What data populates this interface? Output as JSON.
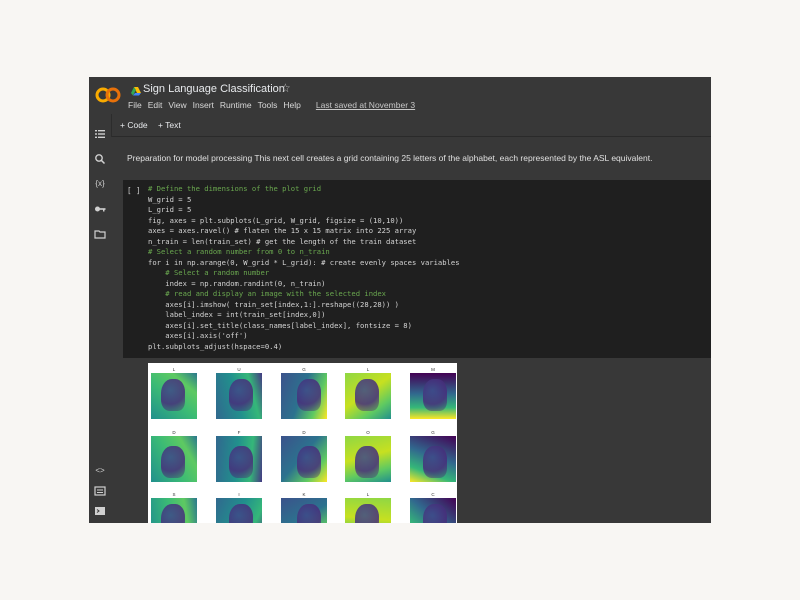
{
  "app": {
    "title": "Sign Language Classification",
    "menu": [
      "File",
      "Edit",
      "View",
      "Insert",
      "Runtime",
      "Tools",
      "Help"
    ],
    "last_saved": "Last saved at November 3",
    "accent": "#f9ab00"
  },
  "toolbar": {
    "code_label": "+ Code",
    "text_label": "+ Text"
  },
  "sidebar": {
    "icons": [
      "toc-icon",
      "search-icon",
      "variables-icon",
      "key-icon",
      "folder-icon",
      "code-snippets-icon",
      "command-palette-icon",
      "terminal-icon"
    ]
  },
  "text_cell": {
    "text": "Preparation for model processing This next cell creates a grid containing 25 letters of the alphabet, each represented by the ASL equivalent."
  },
  "code_cell": {
    "run_bracket": "[ ]",
    "lines": [
      "# Define the dimensions of the plot grid",
      "W_grid = 5",
      "L_grid = 5",
      "fig, axes = plt.subplots(L_grid, W_grid, figsize = (10,10))",
      "axes = axes.ravel() # flaten the 15 x 15 matrix into 225 array",
      "n_train = len(train_set) # get the length of the train dataset",
      "# Select a random number from 0 to n_train",
      "for i in np.arange(0, W_grid * L_grid): # create evenly spaces variables",
      "    # Select a random number",
      "    index = np.random.randint(0, n_train)",
      "    # read and display an image with the selected index",
      "    axes[i].imshow( train_set[index,1:].reshape((28,28)) )",
      "    label_index = int(train_set[index,0])",
      "    axes[i].set_title(class_names[label_index], fontsize = 8)",
      "    axes[i].axis('off')",
      "plt.subplots_adjust(hspace=0.4)"
    ]
  },
  "output_grid": {
    "rows": [
      [
        "L",
        "U",
        "G",
        "L",
        "M"
      ],
      [
        "D",
        "F",
        "D",
        "O",
        "G"
      ],
      [
        "S",
        "I",
        "K",
        "L",
        "C"
      ]
    ]
  }
}
